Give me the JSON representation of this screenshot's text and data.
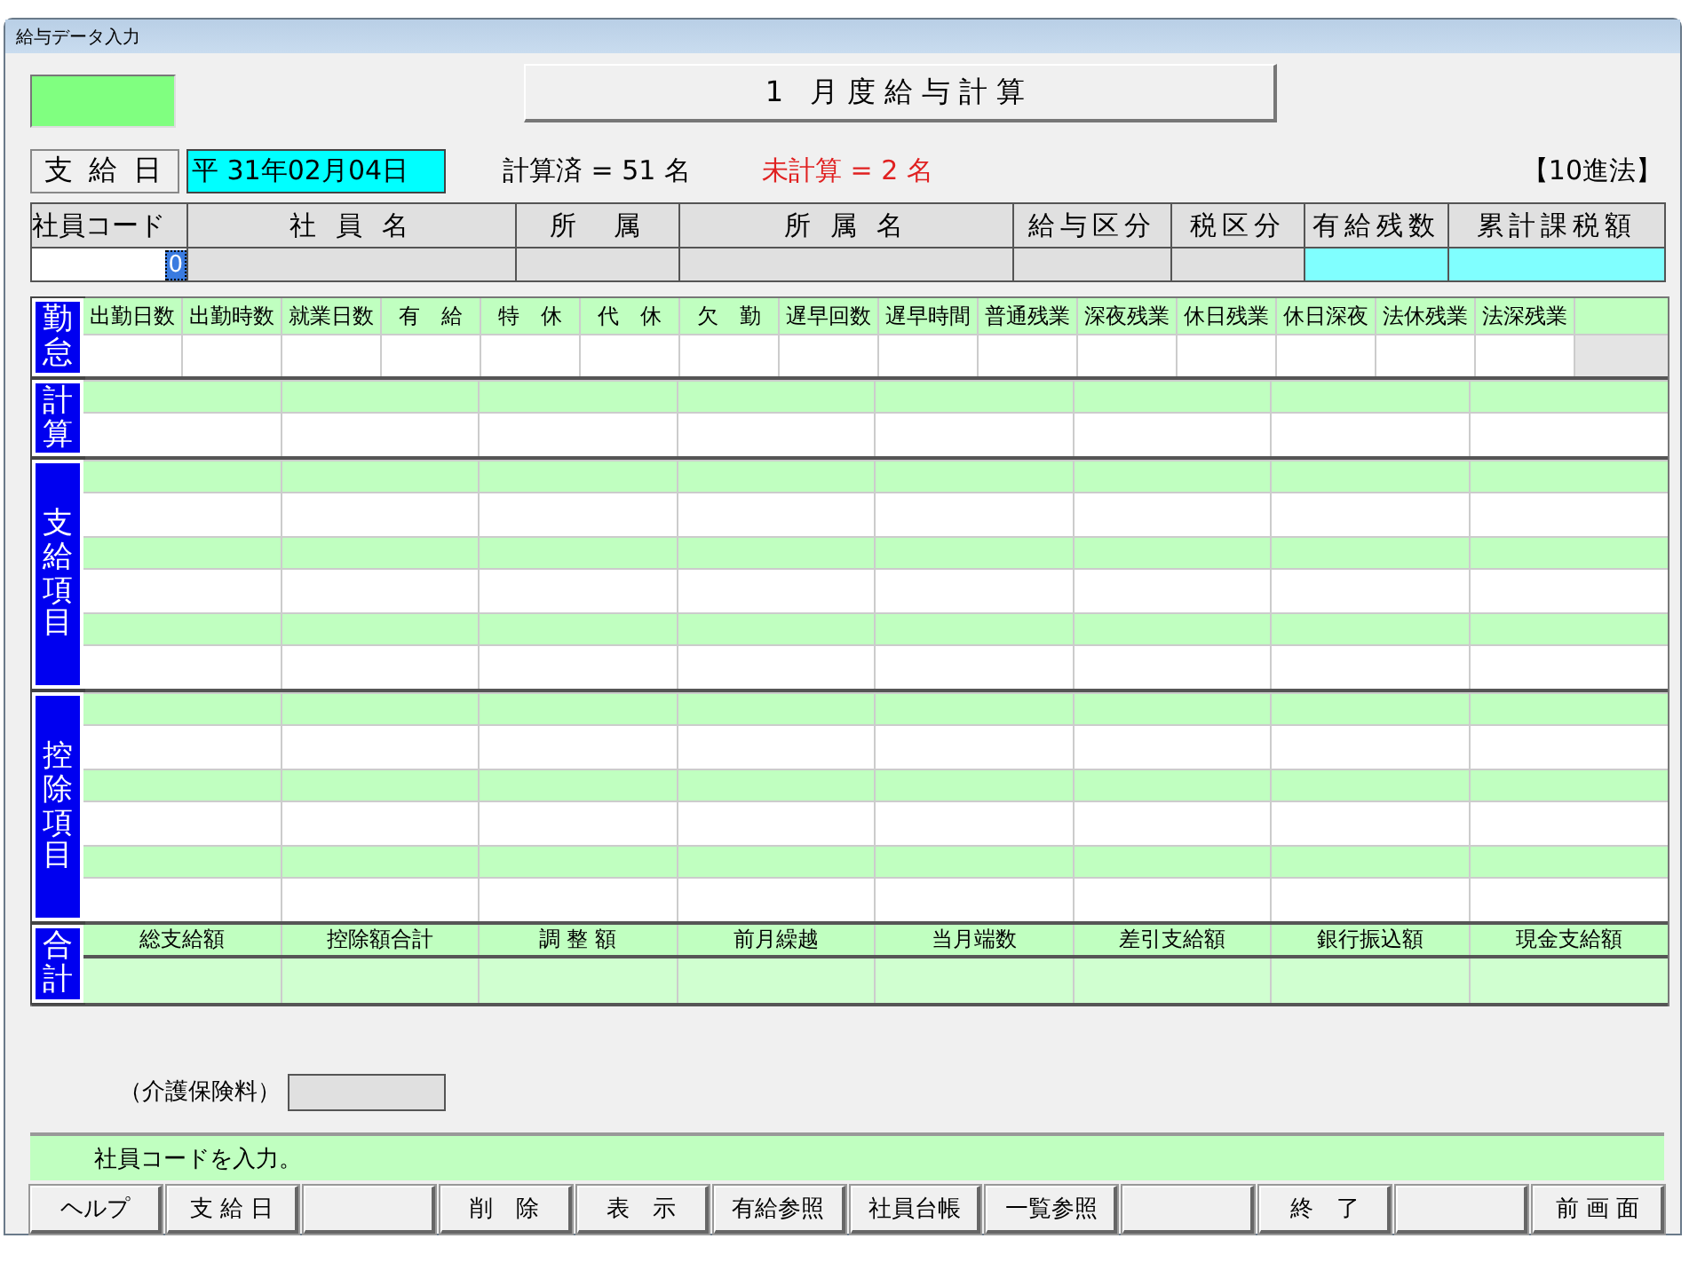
{
  "window": {
    "title": "給与データ入力"
  },
  "heading": "1 月度給与計算",
  "pay_date": {
    "button": "支 給 日",
    "value": "平 31年02月04日"
  },
  "calculated": "計算済 = 51 名",
  "uncalculated": "未計算 = 2 名",
  "mode": "【10進法】",
  "employee_table": {
    "columns": [
      {
        "label": "社員コード",
        "kind": "entry",
        "value": "0",
        "selected": true
      },
      {
        "label": "社 員 名",
        "kind": "display"
      },
      {
        "label": "所　属",
        "kind": "display"
      },
      {
        "label": "所 属 名",
        "kind": "display"
      },
      {
        "label": "給与区分",
        "kind": "display"
      },
      {
        "label": "税区分",
        "kind": "display"
      },
      {
        "label": "有給残数",
        "kind": "balance"
      },
      {
        "label": "累計課税額",
        "kind": "balance"
      }
    ]
  },
  "sections": [
    {
      "label": "勤怠",
      "kind": "attendance",
      "columns": [
        "出勤日数",
        "出勤時数",
        "就業日数",
        "有　給",
        "特　休",
        "代　休",
        "欠　勤",
        "遅早回数",
        "遅早時間",
        "普通残業",
        "深夜残業",
        "休日残業",
        "休日深夜",
        "法休残業",
        "法深残業"
      ]
    },
    {
      "label": "計算",
      "kind": "calc"
    },
    {
      "label": "支給項目",
      "kind": "payments"
    },
    {
      "label": "控除項目",
      "kind": "deductions"
    },
    {
      "label": "合計",
      "kind": "totals",
      "columns": [
        "総支給額",
        "控除額合計",
        "調 整 額",
        "前月繰越",
        "当月端数",
        "差引支給額",
        "銀行振込額",
        "現金支給額"
      ]
    }
  ],
  "care_insurance": {
    "label": "（介護保険料）"
  },
  "status_message": "社員コードを入力。",
  "buttons": [
    {
      "kind": "command",
      "label": "ヘルプ"
    },
    {
      "kind": "command",
      "label": "支 給 日"
    },
    {
      "kind": "blank"
    },
    {
      "kind": "command",
      "label": "削　除"
    },
    {
      "kind": "command",
      "label": "表　示"
    },
    {
      "kind": "command",
      "label": "有給参照"
    },
    {
      "kind": "command",
      "label": "社員台帳"
    },
    {
      "kind": "command",
      "label": "一覧参照"
    },
    {
      "kind": "blank"
    },
    {
      "kind": "command",
      "label": "終　了"
    },
    {
      "kind": "blank"
    },
    {
      "kind": "command",
      "label": "前 画 面"
    }
  ]
}
